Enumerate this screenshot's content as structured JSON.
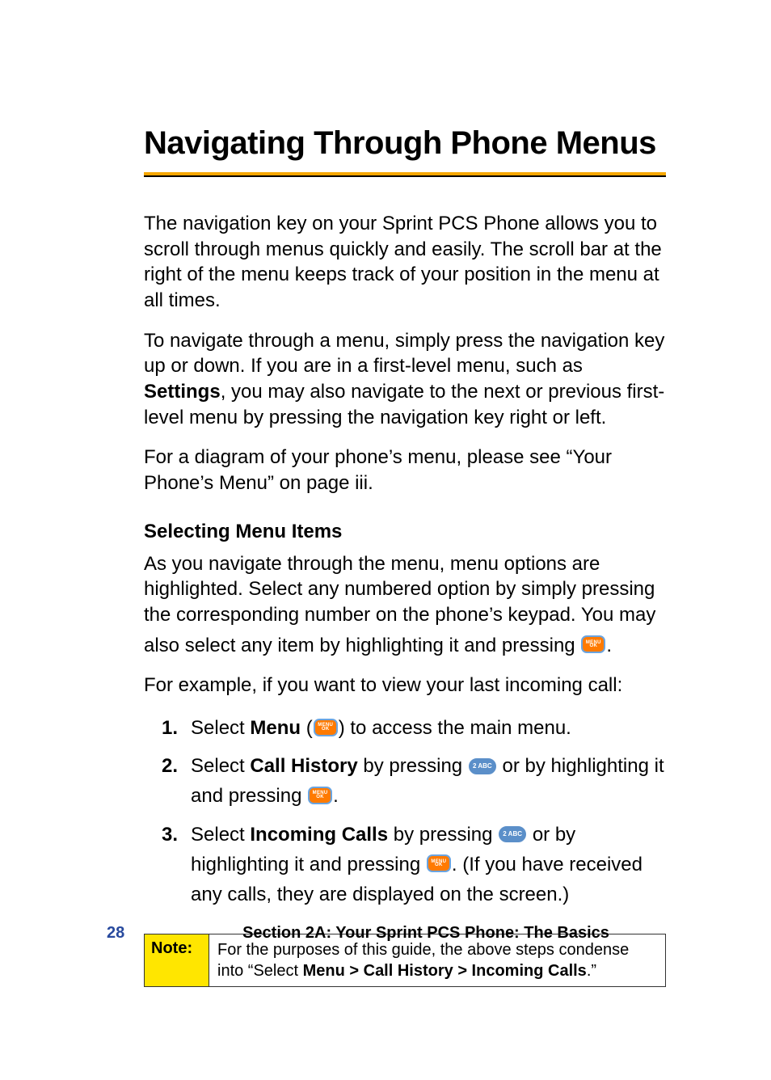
{
  "heading": "Navigating Through Phone Menus",
  "para1": "The navigation key on your Sprint PCS Phone allows you to scroll through menus quickly and easily. The scroll bar at the right of the menu keeps track of your position in the menu at all times.",
  "para2_pre": "To navigate through a menu, simply press the navigation key up or down. If you are in a first-level menu, such as ",
  "para2_bold": "Settings",
  "para2_post": ", you may also navigate to the next or previous first-level menu by pressing the navigation key right or left.",
  "para3": "For a diagram of your phone’s menu, please see “Your Phone’s Menu” on page iii.",
  "subhead": "Selecting Menu Items",
  "para4": "As you navigate through the menu, menu options are highlighted. Select any numbered option by simply pressing the corresponding number on the phone’s keypad. You may",
  "para5_pre": "also select any item by highlighting it and pressing ",
  "para5_post": ".",
  "para6": "For example, if you want to view your last incoming call:",
  "steps": [
    {
      "num": "1.",
      "pre": "Select ",
      "bold": "Menu",
      "mid": " (",
      "aftericon": ") to access the main menu."
    },
    {
      "num": "2.",
      "pre": "Select ",
      "bold": "Call History",
      "mid": " by pressing ",
      "aftericon": " or by highlighting it and pressing ",
      "post": "."
    },
    {
      "num": "3.",
      "pre": "Select ",
      "bold": "Incoming Calls",
      "mid": " by pressing ",
      "aftericon": " or by highlighting it and pressing ",
      "post": ". (If you have received any calls, they are displayed on the screen.)"
    }
  ],
  "icons": {
    "menuok": {
      "l1": "MENU",
      "l2": "OK"
    },
    "key2": "2 ABC"
  },
  "note": {
    "label": "Note:",
    "body_pre": "For the purposes of this guide, the above steps condense into “Select ",
    "body_bold": "Menu > Call History > Incoming Calls",
    "body_post": ".”"
  },
  "footer": {
    "page": "28",
    "section": "Section 2A: Your Sprint PCS Phone: The Basics"
  }
}
